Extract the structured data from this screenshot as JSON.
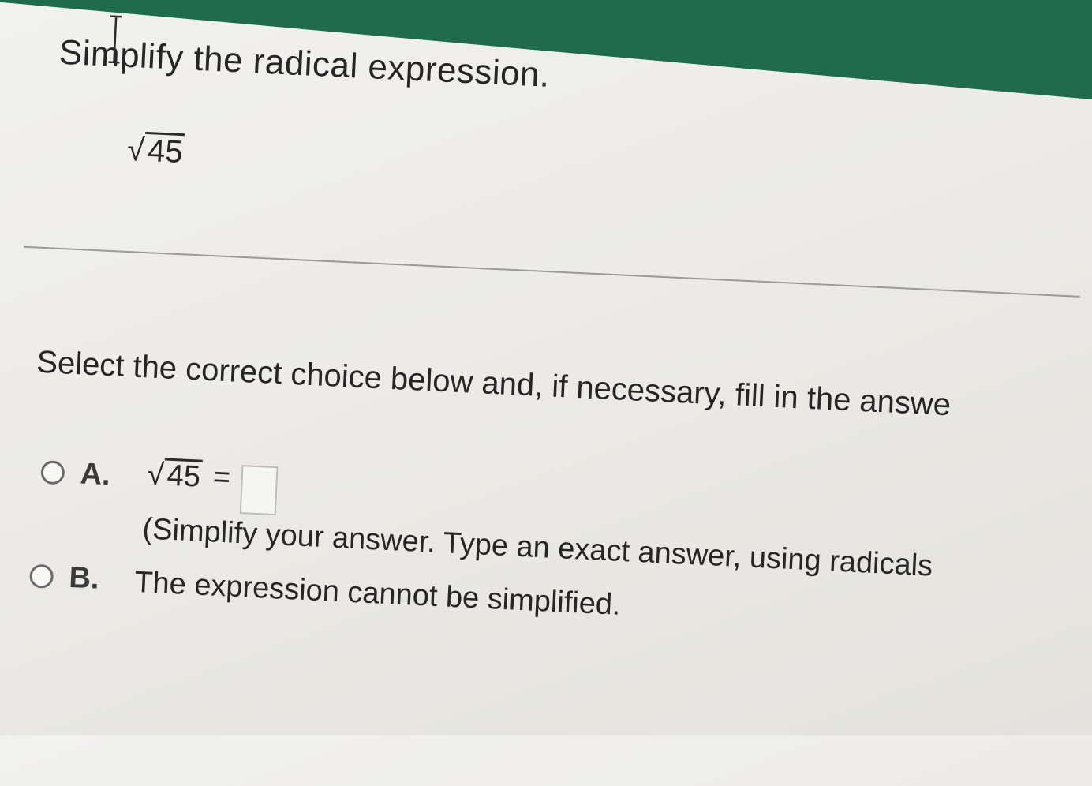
{
  "question": {
    "prompt": "Simplify the radical expression.",
    "expression_radicand": "45"
  },
  "instruction": "Select the correct choice below and, if necessary, fill in the answe",
  "choices": [
    {
      "letter": "A.",
      "radicand": "45",
      "equals": "=",
      "answer_value": "",
      "hint": "(Simplify your answer. Type an exact answer, using radicals"
    },
    {
      "letter": "B.",
      "text": "The expression cannot be simplified."
    }
  ],
  "colors": {
    "header": "#1f6b4b",
    "background": "#ecebe7",
    "text": "#262626"
  },
  "icons": {
    "cursor": "text-cursor-icon",
    "radical": "square-root-icon"
  }
}
